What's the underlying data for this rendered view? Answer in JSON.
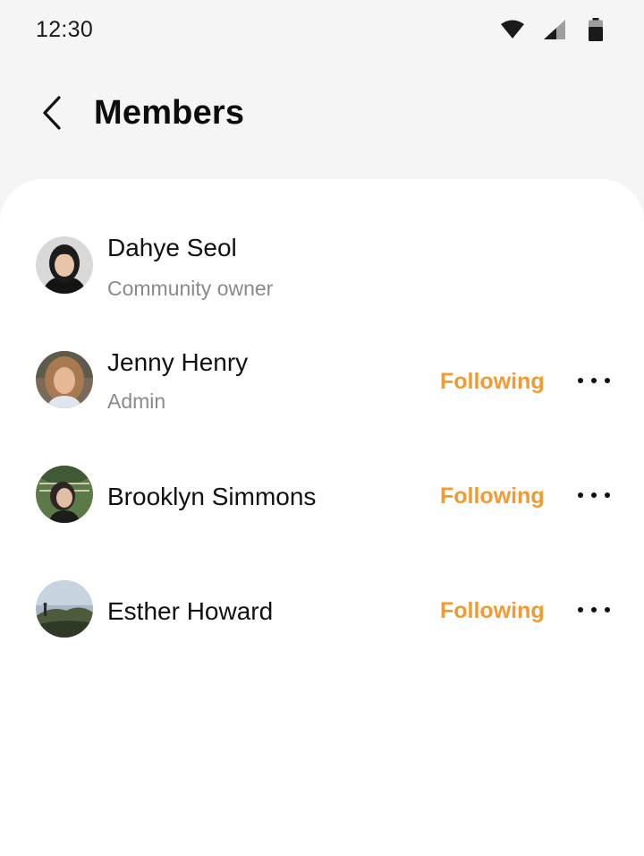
{
  "status_bar": {
    "time": "12:30",
    "icons": [
      "wifi-icon",
      "cellular-signal-icon",
      "battery-icon"
    ]
  },
  "header": {
    "back_icon": "chevron-left-icon",
    "title": "Members"
  },
  "colors": {
    "background": "#f5f5f5",
    "sheet": "#ffffff",
    "accent": "#f39a32",
    "secondary_text": "#8a8a8a"
  },
  "members": [
    {
      "name": "Dahye Seol",
      "role": "Community owner",
      "action": "",
      "more_icon": ""
    },
    {
      "name": "Jenny Henry",
      "role": "Admin",
      "action": "Following",
      "more_icon": "more-horizontal-icon"
    },
    {
      "name": "Brooklyn Simmons",
      "role": "",
      "action": "Following",
      "more_icon": "more-horizontal-icon"
    },
    {
      "name": "Esther Howard",
      "role": "",
      "action": "Following",
      "more_icon": "more-horizontal-icon"
    }
  ]
}
